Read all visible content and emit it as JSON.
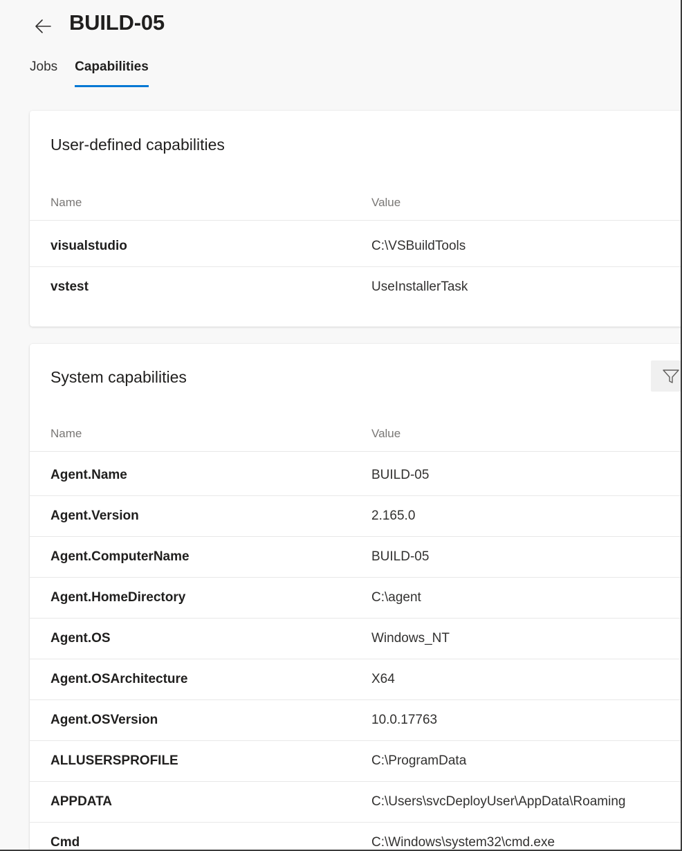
{
  "header": {
    "title": "BUILD-05",
    "back_icon": "arrow-left-icon"
  },
  "tabs": [
    {
      "label": "Jobs",
      "active": false
    },
    {
      "label": "Capabilities",
      "active": true
    }
  ],
  "colors": {
    "accent": "#0078d4",
    "background": "#f8f8f8",
    "card": "#ffffff"
  },
  "user_capabilities": {
    "title": "User-defined capabilities",
    "columns": {
      "name": "Name",
      "value": "Value"
    },
    "rows": [
      {
        "name": "visualstudio",
        "value": "C:\\VSBuildTools"
      },
      {
        "name": "vstest",
        "value": "UseInstallerTask"
      }
    ]
  },
  "system_capabilities": {
    "title": "System capabilities",
    "filter_icon": "filter-icon",
    "columns": {
      "name": "Name",
      "value": "Value"
    },
    "rows": [
      {
        "name": "Agent.Name",
        "value": "BUILD-05"
      },
      {
        "name": "Agent.Version",
        "value": "2.165.0"
      },
      {
        "name": "Agent.ComputerName",
        "value": "BUILD-05"
      },
      {
        "name": "Agent.HomeDirectory",
        "value": "C:\\agent"
      },
      {
        "name": "Agent.OS",
        "value": "Windows_NT"
      },
      {
        "name": "Agent.OSArchitecture",
        "value": "X64"
      },
      {
        "name": "Agent.OSVersion",
        "value": "10.0.17763"
      },
      {
        "name": "ALLUSERSPROFILE",
        "value": "C:\\ProgramData"
      },
      {
        "name": "APPDATA",
        "value": "C:\\Users\\svcDeployUser\\AppData\\Roaming"
      },
      {
        "name": "Cmd",
        "value": "C:\\Windows\\system32\\cmd.exe"
      }
    ]
  }
}
